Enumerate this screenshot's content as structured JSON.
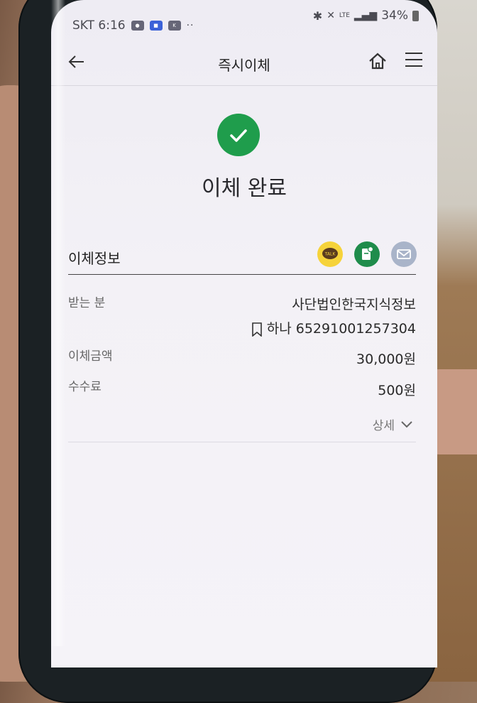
{
  "status_bar": {
    "carrier_time": "SKT 6:16",
    "network": "LTE",
    "battery": "34%"
  },
  "header": {
    "title": "즉시이체"
  },
  "result": {
    "title": "이체 완료"
  },
  "info": {
    "section_title": "이체정보",
    "share": {
      "talk_label": "TALK"
    },
    "rows": [
      {
        "label": "받는 분",
        "value": "사단법인한국지식정보"
      },
      {
        "label": "",
        "value": "하나 65291001257304"
      },
      {
        "label": "이체금액",
        "value": "30,000원"
      },
      {
        "label": "수수료",
        "value": "500원"
      }
    ],
    "detail_label": "상세"
  },
  "colors": {
    "success_green": "#1f9d4c",
    "kakao_yellow": "#f6d33a",
    "mail_grey": "#a9b4c9"
  }
}
